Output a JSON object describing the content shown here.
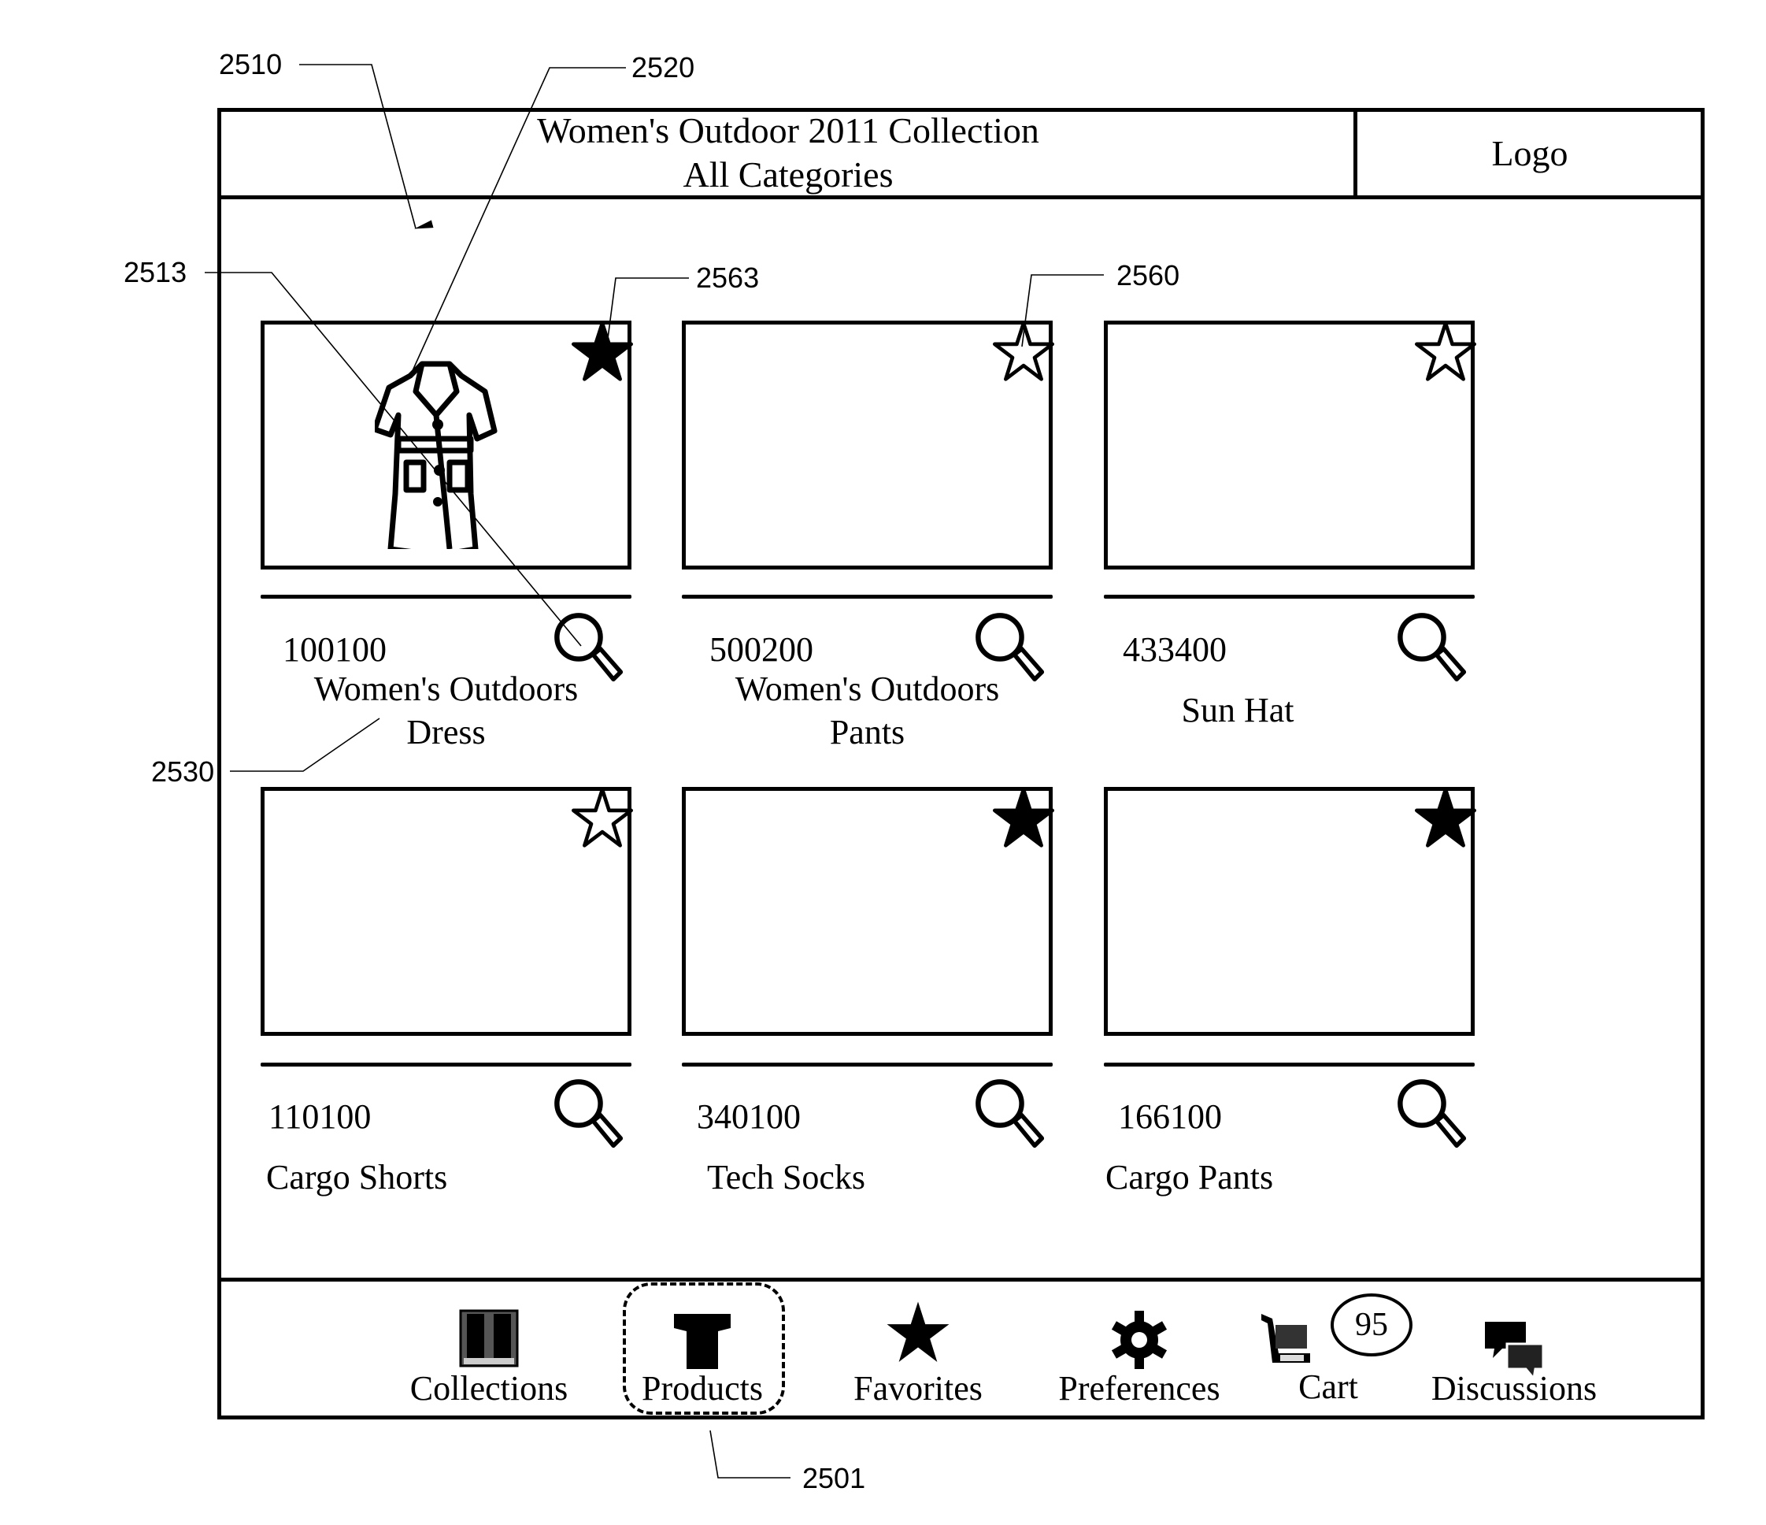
{
  "header": {
    "title_line1": "Women's Outdoor 2011 Collection",
    "title_line2": "All Categories",
    "logo": "Logo"
  },
  "products": [
    {
      "sku": "100100",
      "name_line1": "Women's Outdoors",
      "name_line2": "Dress",
      "favorite": true,
      "has_image": true,
      "image_icon": "dress-icon"
    },
    {
      "sku": "500200",
      "name_line1": "Women's Outdoors",
      "name_line2": "Pants",
      "favorite": false,
      "has_image": false
    },
    {
      "sku": "433400",
      "name_line1": "Sun Hat",
      "name_line2": "",
      "favorite": false,
      "has_image": false
    },
    {
      "sku": "110100",
      "name_line1": "Cargo Shorts",
      "name_line2": "",
      "favorite": false,
      "has_image": false
    },
    {
      "sku": "340100",
      "name_line1": "Tech Socks",
      "name_line2": "",
      "favorite": true,
      "has_image": false
    },
    {
      "sku": "166100",
      "name_line1": "Cargo Pants",
      "name_line2": "",
      "favorite": true,
      "has_image": false
    }
  ],
  "nav": {
    "items": [
      {
        "label": "Collections",
        "icon": "book-icon",
        "selected": false
      },
      {
        "label": "Products",
        "icon": "tshirt-icon",
        "selected": true
      },
      {
        "label": "Favorites",
        "icon": "star-icon",
        "selected": false
      },
      {
        "label": "Preferences",
        "icon": "gear-icon",
        "selected": false
      },
      {
        "label": "Cart",
        "icon": "cart-icon",
        "selected": false,
        "badge": "95"
      },
      {
        "label": "Discussions",
        "icon": "chat-bubbles-icon",
        "selected": false
      }
    ]
  },
  "annotations": {
    "a2510": "2510",
    "a2520": "2520",
    "a2513": "2513",
    "a2563": "2563",
    "a2560": "2560",
    "a2530": "2530",
    "a2501": "2501"
  }
}
